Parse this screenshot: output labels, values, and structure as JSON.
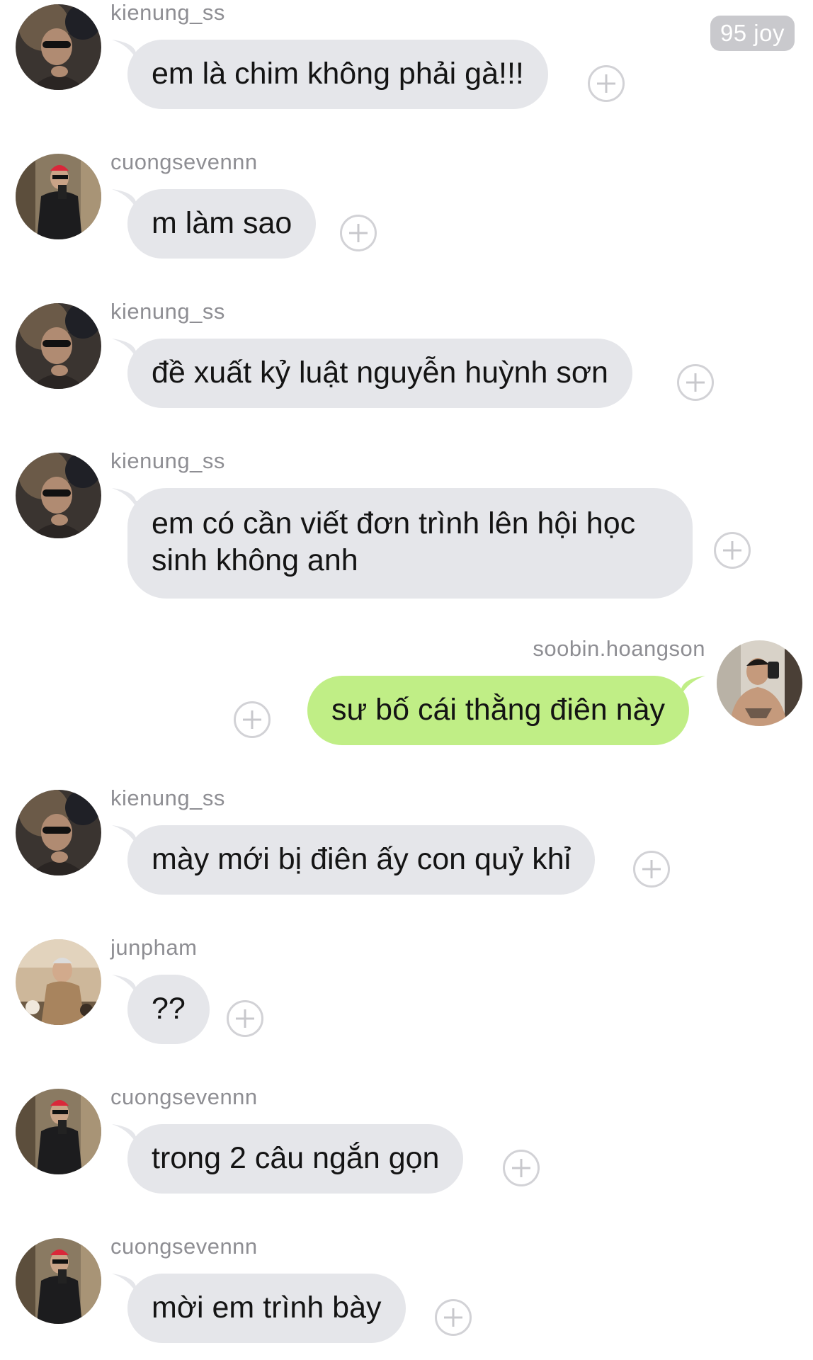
{
  "badge": "95 joy",
  "colors": {
    "incoming_bubble": "#e5e6ea",
    "outgoing_bubble": "#c0ee86",
    "sender_text": "#8e8e93",
    "badge_bg": "#c9c9cd"
  },
  "messages": [
    {
      "sender": "kienung_ss",
      "text": "em là chim không phải gà!!!",
      "direction": "incoming",
      "icon": "add-reaction-icon"
    },
    {
      "sender": "cuongsevennn",
      "text": "m làm sao",
      "direction": "incoming",
      "icon": "add-reaction-icon"
    },
    {
      "sender": "kienung_ss",
      "text": "đề xuất kỷ luật nguyễn huỳnh sơn",
      "direction": "incoming",
      "icon": "add-reaction-icon"
    },
    {
      "sender": "kienung_ss",
      "text": "em có cần viết đơn trình lên hội học sinh không anh",
      "direction": "incoming",
      "icon": "add-reaction-icon"
    },
    {
      "sender": "soobin.hoangson",
      "text": "sư bố cái thằng điên này",
      "direction": "outgoing",
      "icon": "add-reaction-icon"
    },
    {
      "sender": "kienung_ss",
      "text": "mày mới bị điên ấy con quỷ khỉ",
      "direction": "incoming",
      "icon": "add-reaction-icon"
    },
    {
      "sender": "junpham",
      "text": "??",
      "direction": "incoming",
      "icon": "add-reaction-icon"
    },
    {
      "sender": "cuongsevennn",
      "text": "trong 2 câu ngắn gọn",
      "direction": "incoming",
      "icon": "add-reaction-icon"
    },
    {
      "sender": "cuongsevennn",
      "text": "mời em trình bày",
      "direction": "incoming",
      "icon": "add-reaction-icon"
    }
  ]
}
